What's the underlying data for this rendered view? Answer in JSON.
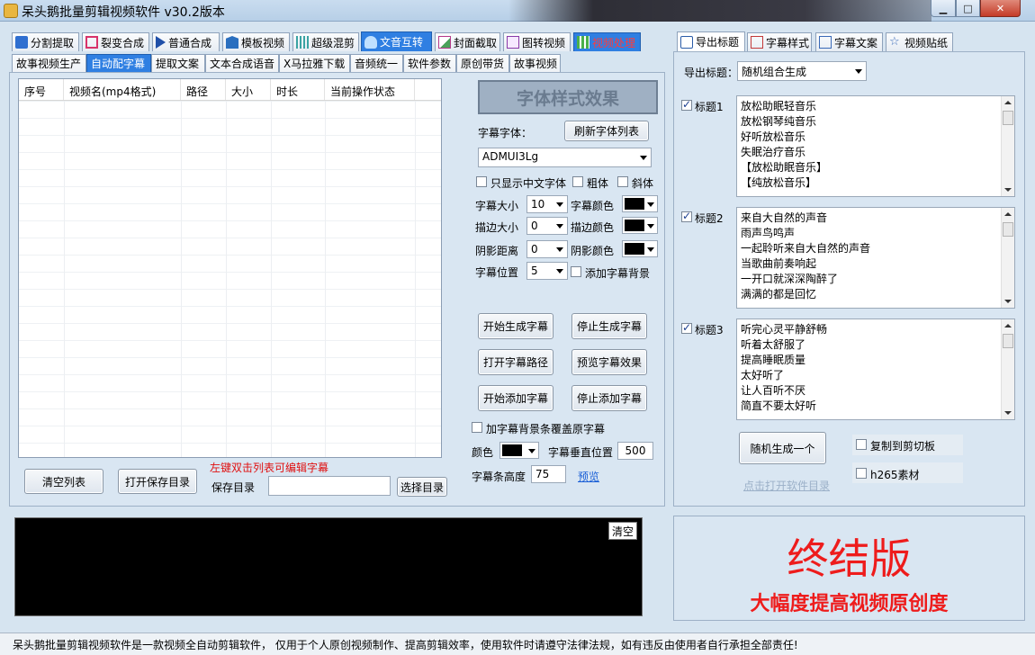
{
  "window": {
    "title": "呆头鹅批量剪辑视频软件    v30.2版本"
  },
  "top_tabs": [
    {
      "label": "分割提取"
    },
    {
      "label": "裂变合成"
    },
    {
      "label": "普通合成"
    },
    {
      "label": "模板视频"
    },
    {
      "label": "超级混剪"
    },
    {
      "label": "文音互转"
    },
    {
      "label": "封面截取"
    },
    {
      "label": "图转视频"
    },
    {
      "label": "视频处理"
    }
  ],
  "sub_tabs": [
    {
      "label": "故事视频生产"
    },
    {
      "label": "自动配字幕"
    },
    {
      "label": "提取文案"
    },
    {
      "label": "文本合成语音"
    },
    {
      "label": "X马拉雅下载"
    },
    {
      "label": "音频统一"
    },
    {
      "label": "软件参数"
    },
    {
      "label": "原创带货"
    },
    {
      "label": "故事视频"
    }
  ],
  "grid": {
    "columns": [
      "序号",
      "视频名(mp4格式)",
      "路径",
      "大小",
      "时长",
      "当前操作状态"
    ]
  },
  "left_bottom": {
    "clear_list": "清空列表",
    "open_save_dir": "打开保存目录",
    "hint": "左键双击列表可编辑字幕",
    "save_dir_label": "保存目录",
    "save_dir_value": "",
    "choose_dir": "选择目录"
  },
  "style_panel": {
    "effect_title": "字体样式效果",
    "font_label": "字幕字体：",
    "refresh_fonts": "刷新字体列表",
    "font_value": "ADMUI3Lg",
    "only_chinese": "只显示中文字体",
    "bold": "粗体",
    "italic": "斜体",
    "size_label": "字幕大小",
    "size_value": "10",
    "color_label": "字幕颜色",
    "stroke_size_label": "描边大小",
    "stroke_size_value": "0",
    "stroke_color_label": "描边颜色",
    "shadow_label": "阴影距离",
    "shadow_value": "0",
    "shadow_color_label": "阴影颜色",
    "position_label": "字幕位置",
    "position_value": "5",
    "add_bg_label": "添加字幕背景",
    "start_gen": "开始生成字幕",
    "stop_gen": "停止生成字幕",
    "open_path": "打开字幕路径",
    "preview_effect": "预览字幕效果",
    "start_add": "开始添加字幕",
    "stop_add": "停止添加字幕",
    "bg_cover": "加字幕背景条覆盖原字幕",
    "color_label2": "颜色",
    "vertical_pos_label": "字幕垂直位置",
    "vertical_pos_value": "500",
    "bar_height_label": "字幕条高度",
    "bar_height_value": "75",
    "preview_link": "预览"
  },
  "log": {
    "clear": "清空"
  },
  "right_tabs": [
    {
      "label": "导出标题"
    },
    {
      "label": "字幕样式"
    },
    {
      "label": "字幕文案"
    },
    {
      "label": "视频贴纸"
    }
  ],
  "export": {
    "label": "导出标题：",
    "mode": "随机组合生成",
    "titles": [
      {
        "label": "标题1",
        "lines": [
          "放松助眠轻音乐",
          "放松钢琴纯音乐",
          "好听放松音乐",
          "失眠治疗音乐",
          "【放松助眠音乐】",
          "【纯放松音乐】"
        ]
      },
      {
        "label": "标题2",
        "lines": [
          "来自大自然的声音",
          "雨声鸟鸣声",
          "一起聆听来自大自然的声音",
          "当歌曲前奏响起",
          "一开口就深深陶醉了",
          "满满的都是回忆"
        ]
      },
      {
        "label": "标题3",
        "lines": [
          "听完心灵平静舒畅",
          "听着太舒服了",
          "提高睡眠质量",
          "太好听了",
          "让人百听不厌",
          "简直不要太好听"
        ]
      }
    ],
    "random_gen": "随机生成一个",
    "copy_clipboard": "复制到剪切板",
    "h265": "h265素材",
    "open_dir_link": "点击打开软件目录"
  },
  "promo": {
    "big": "终结版",
    "sub": "大幅度提高视频原创度"
  },
  "status": {
    "text": "呆头鹅批量剪辑视频软件是一款视频全自动剪辑软件， 仅用于个人原创视频制作、提高剪辑效率，使用软件时请遵守法律法规，如有违反由使用者自行承担全部责任!"
  }
}
